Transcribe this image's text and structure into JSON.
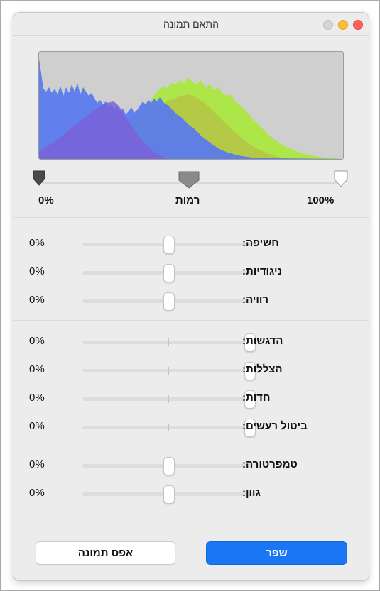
{
  "window": {
    "title": "התאם תמונה"
  },
  "levels": {
    "label": "רמות",
    "min_label": "0%",
    "max_label": "100%"
  },
  "sliders": [
    {
      "key": "exposure",
      "label": "חשיפה:",
      "value": "0%",
      "position": 0.5
    },
    {
      "key": "contrast",
      "label": "ניגודיות:",
      "value": "0%",
      "position": 0.5
    },
    {
      "key": "saturation",
      "label": "רוויה:",
      "value": "0%",
      "position": 0.5
    },
    {
      "key": "highlights",
      "label": "הדגשות:",
      "value": "0%",
      "position": 1.0
    },
    {
      "key": "shadows",
      "label": "הצללות:",
      "value": "0%",
      "position": 1.0
    },
    {
      "key": "sharpness",
      "label": "חדות:",
      "value": "0%",
      "position": 1.0
    },
    {
      "key": "denoise",
      "label": "ביטול רעשים:",
      "value": "0%",
      "position": 1.0
    },
    {
      "key": "temperature",
      "label": "טמפרטורה:",
      "value": "0%",
      "position": 0.5
    },
    {
      "key": "tint",
      "label": "גוון:",
      "value": "0%",
      "position": 0.5
    }
  ],
  "buttons": {
    "reset_label": "אפס תמונה",
    "enhance_label": "שפר"
  },
  "colors": {
    "accent": "#1b76f6",
    "histogram_blue": "#5878f0",
    "histogram_green": "#a8e838",
    "histogram_yellow": "#b4c848",
    "histogram_purple": "#7a62d8",
    "histogram_background": "#cfcfcf"
  }
}
